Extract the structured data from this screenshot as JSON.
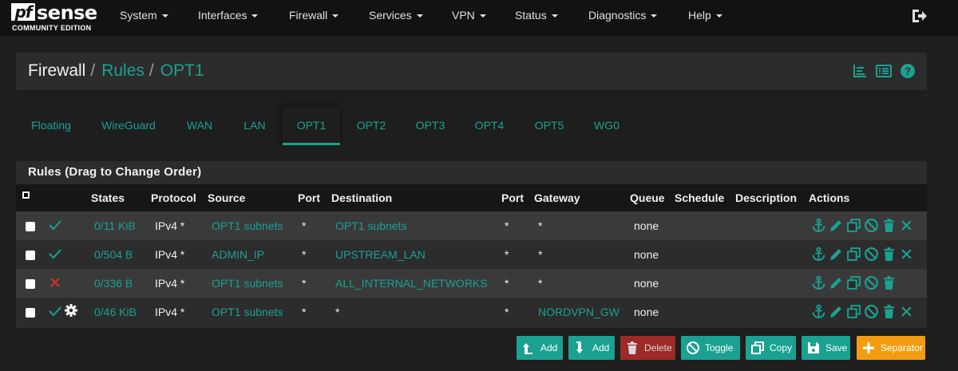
{
  "brand": {
    "logo_pf": "pf",
    "logo_sense": "sense",
    "edition": "COMMUNITY EDITION"
  },
  "nav": [
    "System",
    "Interfaces",
    "Firewall",
    "Services",
    "VPN",
    "Status",
    "Diagnostics",
    "Help"
  ],
  "breadcrumb": {
    "root": "Firewall",
    "section": "Rules",
    "page": "OPT1",
    "separator": "/"
  },
  "tabs": [
    "Floating",
    "WireGuard",
    "WAN",
    "LAN",
    "OPT1",
    "OPT2",
    "OPT3",
    "OPT4",
    "OPT5",
    "WG0"
  ],
  "active_tab": "OPT1",
  "panel_title": "Rules (Drag to Change Order)",
  "columns": [
    "States",
    "Protocol",
    "Source",
    "Port",
    "Destination",
    "Port",
    "Gateway",
    "Queue",
    "Schedule",
    "Description",
    "Actions"
  ],
  "rules": [
    {
      "status": "pass",
      "states": "0/11 KiB",
      "protocol": "IPv4 *",
      "source": "OPT1 subnets",
      "sport": "*",
      "destination": "OPT1 subnets",
      "dport": "*",
      "gateway": "*",
      "queue": "none",
      "schedule": "",
      "description": "",
      "has_gear": false
    },
    {
      "status": "pass",
      "states": "0/504 B",
      "protocol": "IPv4 *",
      "source": "ADMIN_IP",
      "sport": "*",
      "destination": "UPSTREAM_LAN",
      "dport": "*",
      "gateway": "*",
      "queue": "none",
      "schedule": "",
      "description": "",
      "has_gear": false
    },
    {
      "status": "block",
      "states": "0/336 B",
      "protocol": "IPv4 *",
      "source": "OPT1 subnets",
      "sport": "*",
      "destination": "ALL_INTERNAL_NETWORKS",
      "dport": "*",
      "gateway": "*",
      "queue": "none",
      "schedule": "",
      "description": "",
      "has_gear": false
    },
    {
      "status": "pass",
      "states": "0/46 KiB",
      "protocol": "IPv4 *",
      "source": "OPT1 subnets",
      "sport": "*",
      "destination": "*",
      "dport": "*",
      "gateway": "NORDVPN_GW",
      "queue": "none",
      "schedule": "",
      "description": "",
      "has_gear": true
    }
  ],
  "buttons": {
    "add_top": "Add",
    "add_bottom": "Add",
    "delete": "Delete",
    "toggle": "Toggle",
    "copy": "Copy",
    "save": "Save",
    "separator": "Separator"
  },
  "colors": {
    "accent": "#1aa191",
    "pass": "#1aa191",
    "block": "#d9302b",
    "delete": "#9d2a27",
    "separator": "#f39c12",
    "navbar": "#121212"
  }
}
